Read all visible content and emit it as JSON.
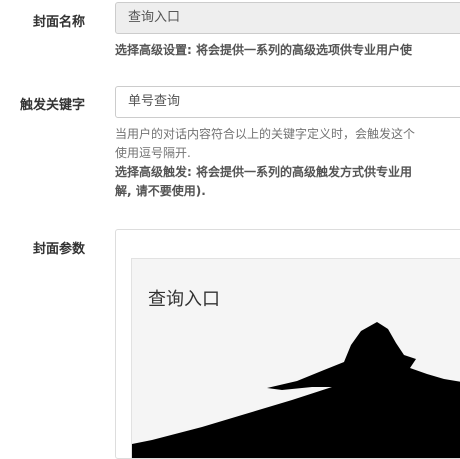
{
  "cover_name": {
    "label": "封面名称",
    "value": "查询入口",
    "help_strong": "选择高级设置: 将会提供一系列的高级选项供专业用户使"
  },
  "trigger_keyword": {
    "label": "触发关键字",
    "value": "单号查询",
    "help_line1": "当用户的对话内容符合以上的关键字定义时，会触发这个",
    "help_line2": "使用逗号隔开.",
    "help_strong_line1": "选择高级触发: 将会提供一系列的高级触发方式供专业用",
    "help_strong_line2": "解, 请不要使用)."
  },
  "cover_params": {
    "label": "封面参数",
    "preview_title": "查询入口",
    "image_icon": "pagoda-roof-silhouette-icon"
  }
}
